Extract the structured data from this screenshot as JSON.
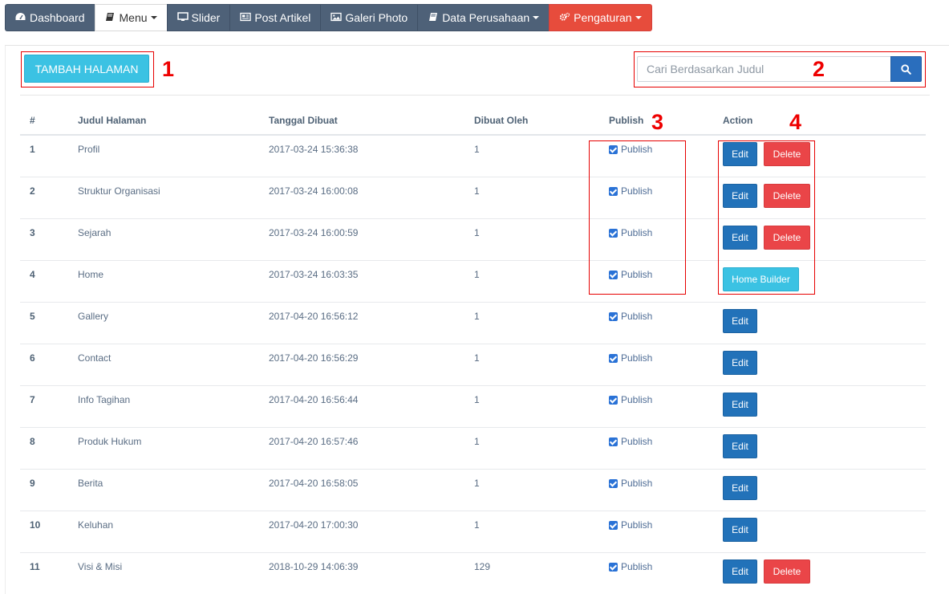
{
  "nav": [
    {
      "label": "Dashboard",
      "icon": "dashboard-icon",
      "style": "dark"
    },
    {
      "label": "Menu",
      "icon": "book-icon",
      "style": "active",
      "dropdown": true
    },
    {
      "label": "Slider",
      "icon": "monitor-icon",
      "style": "dark"
    },
    {
      "label": "Post Artikel",
      "icon": "newspaper-icon",
      "style": "dark"
    },
    {
      "label": "Galeri Photo",
      "icon": "picture-icon",
      "style": "dark"
    },
    {
      "label": "Data Perusahaan",
      "icon": "book-icon",
      "style": "dark",
      "dropdown": true
    },
    {
      "label": "Pengaturan",
      "icon": "gears-icon",
      "style": "danger",
      "dropdown": true
    }
  ],
  "toolbar": {
    "add_label": "TAMBAH HALAMAN",
    "search_placeholder": "Cari Berdasarkan Judul",
    "search_icon": "search-icon"
  },
  "annotations": {
    "n1": "1",
    "n2": "2",
    "n3": "3",
    "n4": "4"
  },
  "table": {
    "headers": {
      "num": "#",
      "title": "Judul Halaman",
      "date": "Tanggal Dibuat",
      "by": "Dibuat Oleh",
      "publish": "Publish",
      "action": "Action"
    },
    "publish_label": "Publish",
    "edit_label": "Edit",
    "delete_label": "Delete",
    "home_builder_label": "Home Builder",
    "rows": [
      {
        "num": "1",
        "title": "Profil",
        "date": "2017-03-24 15:36:38",
        "by": "1",
        "published": true,
        "actions": [
          "edit",
          "delete"
        ]
      },
      {
        "num": "2",
        "title": "Struktur Organisasi",
        "date": "2017-03-24 16:00:08",
        "by": "1",
        "published": true,
        "actions": [
          "edit",
          "delete"
        ]
      },
      {
        "num": "3",
        "title": "Sejarah",
        "date": "2017-03-24 16:00:59",
        "by": "1",
        "published": true,
        "actions": [
          "edit",
          "delete"
        ]
      },
      {
        "num": "4",
        "title": "Home",
        "date": "2017-03-24 16:03:35",
        "by": "1",
        "published": true,
        "actions": [
          "home_builder"
        ]
      },
      {
        "num": "5",
        "title": "Gallery",
        "date": "2017-04-20 16:56:12",
        "by": "1",
        "published": true,
        "actions": [
          "edit"
        ]
      },
      {
        "num": "6",
        "title": "Contact",
        "date": "2017-04-20 16:56:29",
        "by": "1",
        "published": true,
        "actions": [
          "edit"
        ]
      },
      {
        "num": "7",
        "title": "Info Tagihan",
        "date": "2017-04-20 16:56:44",
        "by": "1",
        "published": true,
        "actions": [
          "edit"
        ]
      },
      {
        "num": "8",
        "title": "Produk Hukum",
        "date": "2017-04-20 16:57:46",
        "by": "1",
        "published": true,
        "actions": [
          "edit"
        ]
      },
      {
        "num": "9",
        "title": "Berita",
        "date": "2017-04-20 16:58:05",
        "by": "1",
        "published": true,
        "actions": [
          "edit"
        ]
      },
      {
        "num": "10",
        "title": "Keluhan",
        "date": "2017-04-20 17:00:30",
        "by": "1",
        "published": true,
        "actions": [
          "edit"
        ]
      },
      {
        "num": "11",
        "title": "Visi & Misi",
        "date": "2018-10-29 14:06:39",
        "by": "129",
        "published": true,
        "actions": [
          "edit",
          "delete"
        ]
      }
    ]
  },
  "colors": {
    "nav_dark": "#4e6178",
    "danger": "#e74c3c",
    "info": "#3bc2e3",
    "primary": "#2272b9",
    "annotation_red": "#ee0000"
  }
}
